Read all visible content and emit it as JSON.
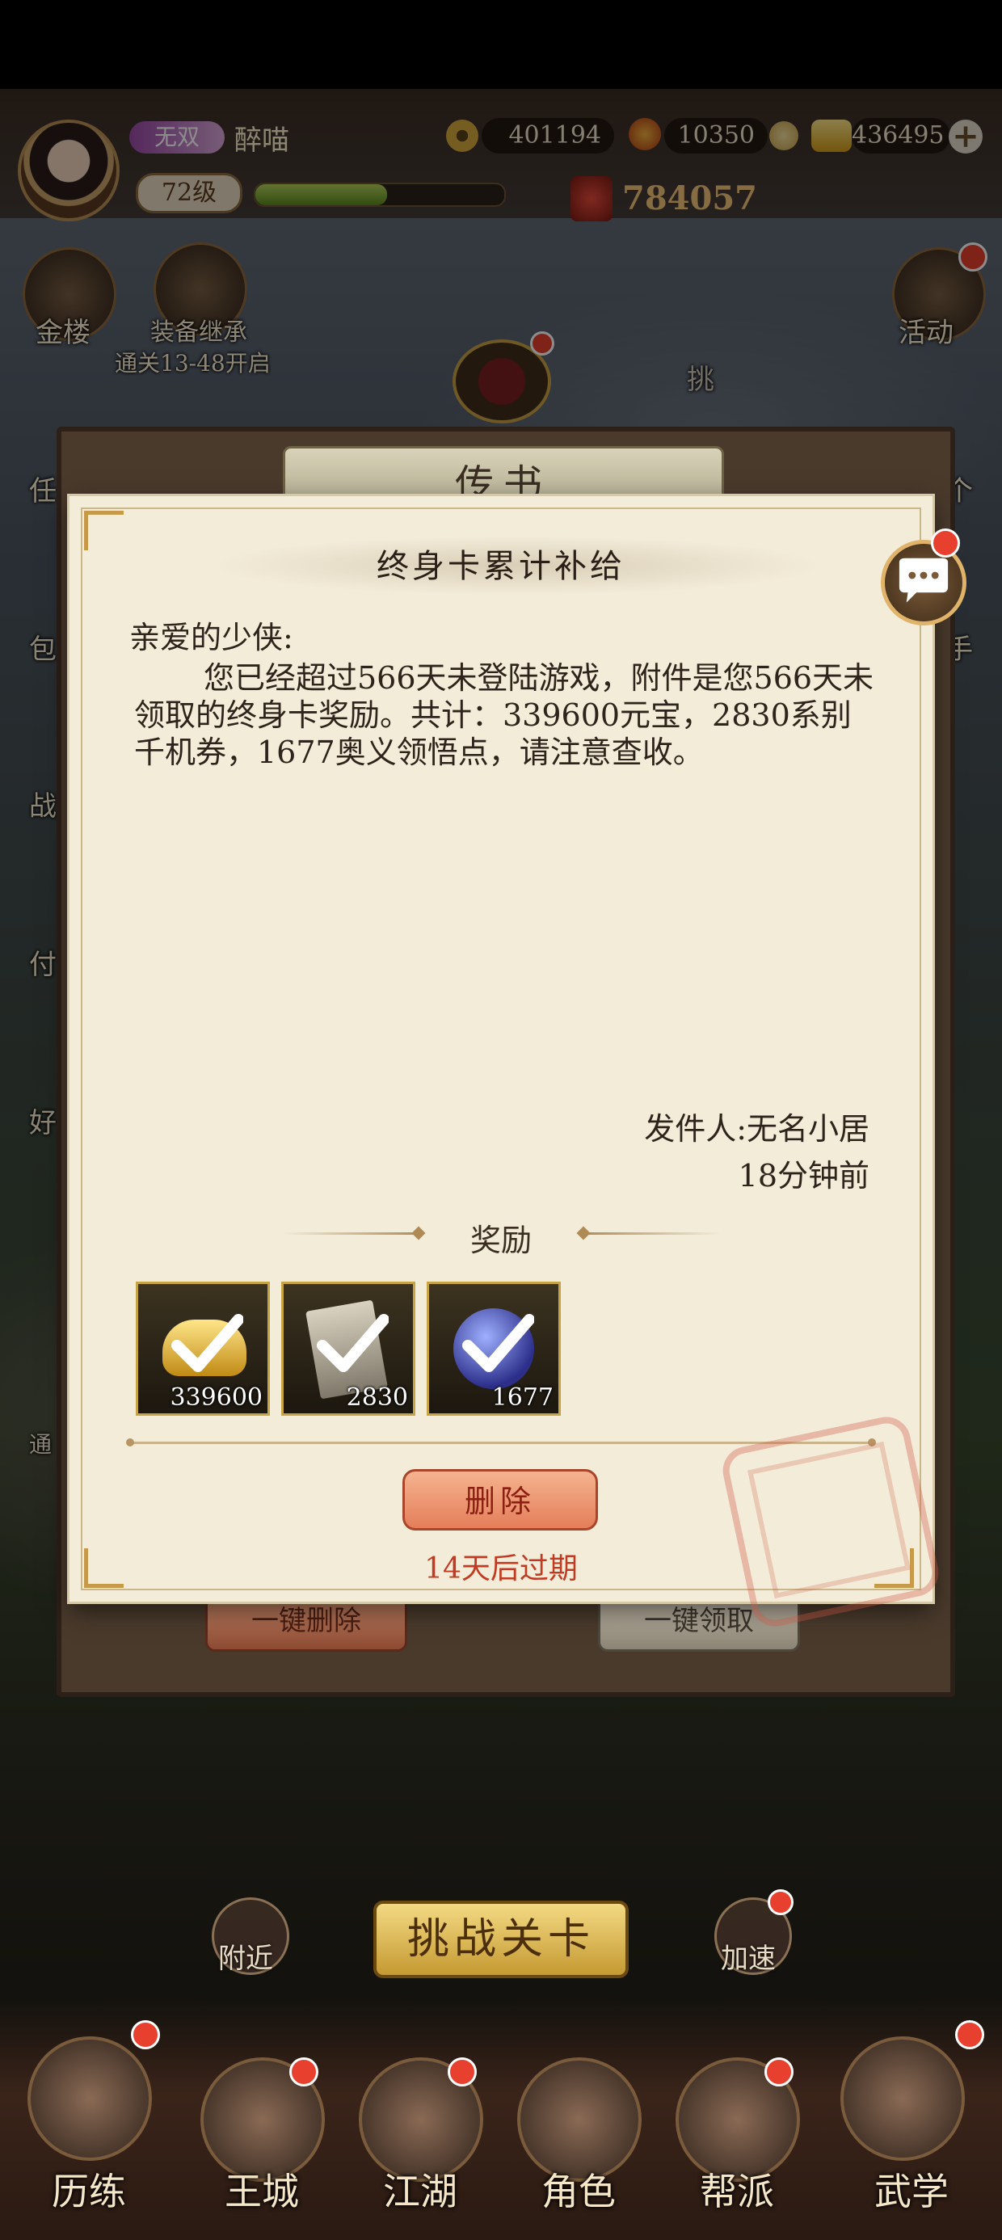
{
  "player": {
    "title_badge": "无双",
    "name": "醉喵",
    "level": "72级",
    "xp_fraction": 0.53
  },
  "currencies": {
    "copper": "401194",
    "stamina": "10350",
    "gold": "436495",
    "power": "784057"
  },
  "side_left": {
    "jinlou": "金楼",
    "equip_inherit": "装备继承",
    "equip_inherit_hint": "通关13-48开启",
    "partial_labels": [
      "任",
      "包",
      "战",
      "付",
      "好",
      "通"
    ]
  },
  "side_right": {
    "activity": "活动",
    "partial_labels": [
      "挑",
      "个",
      "手"
    ]
  },
  "mail_panel": {
    "title": "传书",
    "delete_all": "一键删除",
    "claim_all": "一键领取"
  },
  "mail": {
    "subject": "终身卡累计补给",
    "greeting": "亲爱的少侠:",
    "body": "您已经超过566天未登陆游戏，附件是您566天未领取的终身卡奖励。共计：339600元宝，2830系别千机券，1677奥义领悟点，请注意查收。",
    "sender": "发件人:无名小居",
    "time": "18分钟前",
    "reward_title": "奖励",
    "rewards": [
      {
        "icon": "gold-ingot-icon",
        "count": "339600"
      },
      {
        "icon": "ticket-icon",
        "count": "2830"
      },
      {
        "icon": "orb-icon",
        "count": "1677"
      }
    ],
    "delete_label": "删除",
    "expire_text": "14天后过期"
  },
  "bottom": {
    "nearby": "附近",
    "challenge": "挑战关卡",
    "speedup": "加速"
  },
  "nav": [
    {
      "label": "历练"
    },
    {
      "label": "王城"
    },
    {
      "label": "江湖"
    },
    {
      "label": "角色"
    },
    {
      "label": "帮派"
    },
    {
      "label": "武学"
    }
  ]
}
